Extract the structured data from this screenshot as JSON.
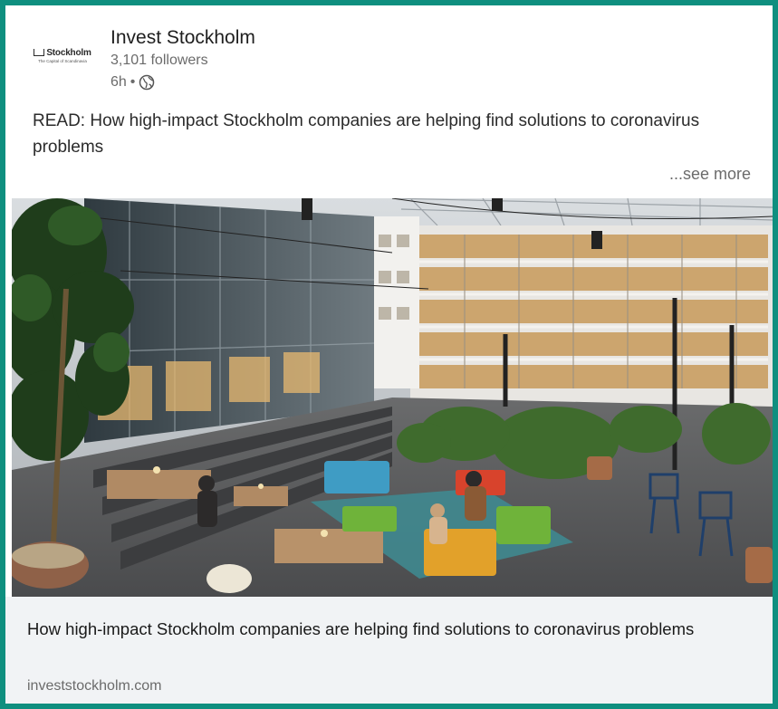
{
  "post": {
    "company_name": "Invest Stockholm",
    "logo_text": "Stockholm",
    "logo_tagline": "The Capital of Scandinavia",
    "followers": "3,101 followers",
    "time_ago": "6h",
    "separator": "•",
    "visibility_icon": "globe-icon",
    "text": "READ: How high-impact Stockholm companies are helping find solutions to coronavirus problems",
    "see_more": "...see more"
  },
  "link_preview": {
    "title": "How high-impact Stockholm companies are helping find solutions to coronavirus problems",
    "domain": "investstockholm.com"
  },
  "colors": {
    "frame_border": "#0f8f7f",
    "link_bar_bg": "#f1f3f5"
  }
}
